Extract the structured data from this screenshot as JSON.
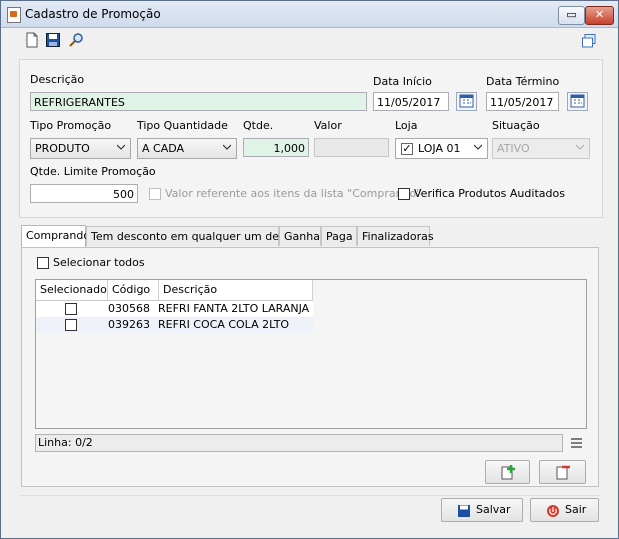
{
  "window": {
    "title": "Cadastro de Promoção"
  },
  "form": {
    "descricao_label": "Descrição",
    "descricao_value": "REFRIGERANTES",
    "data_inicio_label": "Data Início",
    "data_inicio_value": "11/05/2017",
    "data_termino_label": "Data Término",
    "data_termino_value": "11/05/2017",
    "tipo_promocao_label": "Tipo Promoção",
    "tipo_promocao_value": "PRODUTO",
    "tipo_quantidade_label": "Tipo Quantidade",
    "tipo_quantidade_value": "A CADA",
    "qtde_label": "Qtde.",
    "qtde_value": "1,000",
    "valor_label": "Valor",
    "valor_value": "",
    "loja_label": "Loja",
    "loja_value": "LOJA 01",
    "situacao_label": "Situação",
    "situacao_value": "ATIVO",
    "qtde_limite_label": "Qtde. Limite Promoção",
    "qtde_limite_value": "500",
    "valor_referente_label": "Valor referente aos itens da lista \"Comprando\"",
    "verifica_label": "Verifica Produtos Auditados"
  },
  "tabs": [
    {
      "label": "Comprando",
      "active": true
    },
    {
      "label": "Tem desconto em qualquer um desses",
      "active": false
    },
    {
      "label": "Ganha",
      "active": false
    },
    {
      "label": "Paga",
      "active": false
    },
    {
      "label": "Finalizadoras",
      "active": false
    }
  ],
  "comprando": {
    "select_all_label": "Selecionar todos",
    "columns": [
      "Selecionado",
      "Código",
      "Descrição"
    ],
    "rows": [
      {
        "selected": false,
        "codigo": "030568",
        "descricao": "REFRI FANTA 2LTO LARANJA"
      },
      {
        "selected": false,
        "codigo": "039263",
        "descricao": "REFRI COCA COLA 2LTO"
      }
    ],
    "status": "Linha: 0/2"
  },
  "footer": {
    "save_label": "Salvar",
    "exit_label": "Sair"
  },
  "colors": {
    "accent": "#2f64c8",
    "field_green": "#dff4e7",
    "add_icon": "#2aa63a",
    "remove_icon": "#d23b2d"
  }
}
